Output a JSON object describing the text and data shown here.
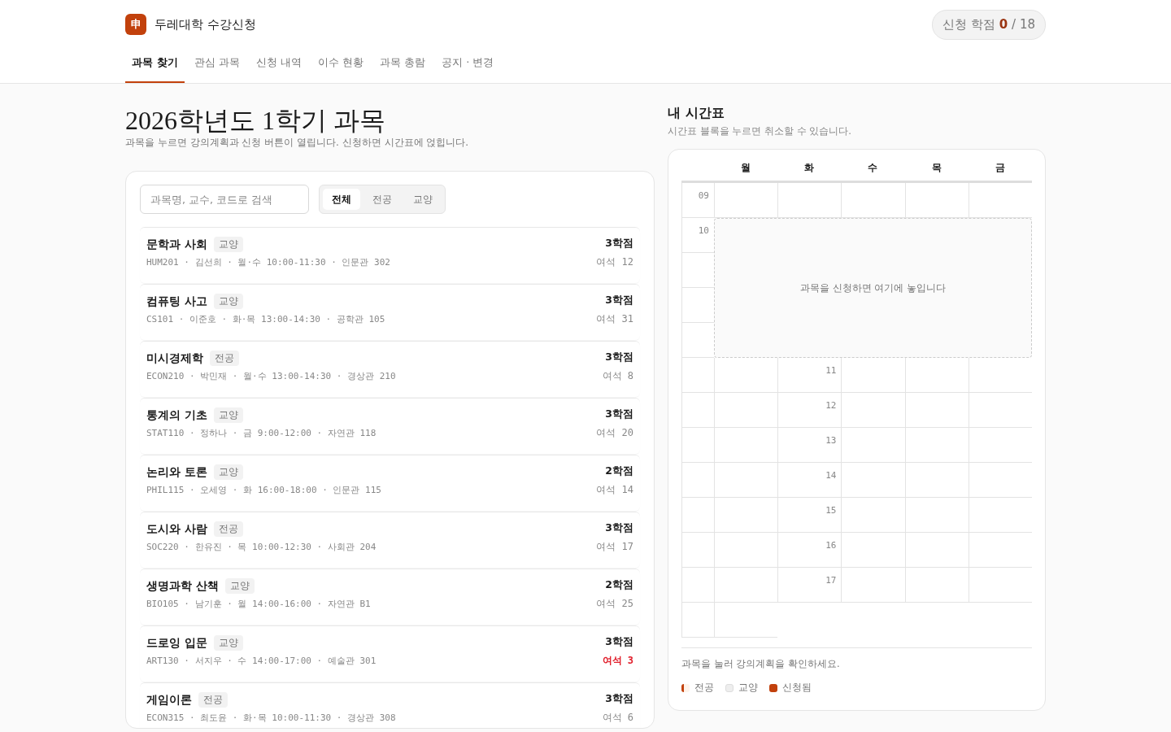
{
  "brand": {
    "logo": "申",
    "name": "두레대학 수강신청"
  },
  "credits": {
    "label": "신청 학점",
    "value": "0",
    "total": "/ 18"
  },
  "tabs": [
    {
      "label": "과목 찾기",
      "selected": true
    },
    {
      "label": "관심 과목",
      "selected": false
    },
    {
      "label": "신청 내역",
      "selected": false
    },
    {
      "label": "이수 현황",
      "selected": false
    },
    {
      "label": "과목 총람",
      "selected": false
    },
    {
      "label": "공지 · 변경",
      "selected": false
    }
  ],
  "page": {
    "title": "2026학년도 1학기 과목",
    "subtitle": "과목을 누르면 강의계획과 신청 버튼이 열립니다. 신청하면 시간표에 얹힙니다."
  },
  "search": {
    "placeholder": "과목명, 교수, 코드로 검색"
  },
  "filters": [
    {
      "label": "전체",
      "selected": true
    },
    {
      "label": "전공",
      "selected": false
    },
    {
      "label": "교양",
      "selected": false
    }
  ],
  "courses": [
    {
      "name": "문학과 사회",
      "tag": "교양",
      "meta": "HUM201 · 김선희 · 월·수 10:00-11:30 · 인문관 302",
      "credits": "3학점",
      "seats": "여석 12",
      "low": false
    },
    {
      "name": "컴퓨팅 사고",
      "tag": "교양",
      "meta": "CS101 · 이준호 · 화·목 13:00-14:30 · 공학관 105",
      "credits": "3학점",
      "seats": "여석 31",
      "low": false
    },
    {
      "name": "미시경제학",
      "tag": "전공",
      "meta": "ECON210 · 박민재 · 월·수 13:00-14:30 · 경상관 210",
      "credits": "3학점",
      "seats": "여석 8",
      "low": false
    },
    {
      "name": "통계의 기초",
      "tag": "교양",
      "meta": "STAT110 · 정하나 · 금 9:00-12:00 · 자연관 118",
      "credits": "3학점",
      "seats": "여석 20",
      "low": false
    },
    {
      "name": "논리와 토론",
      "tag": "교양",
      "meta": "PHIL115 · 오세영 · 화 16:00-18:00 · 인문관 115",
      "credits": "2학점",
      "seats": "여석 14",
      "low": false
    },
    {
      "name": "도시와 사람",
      "tag": "전공",
      "meta": "SOC220 · 한유진 · 목 10:00-12:30 · 사회관 204",
      "credits": "3학점",
      "seats": "여석 17",
      "low": false
    },
    {
      "name": "생명과학 산책",
      "tag": "교양",
      "meta": "BIO105 · 남기훈 · 월 14:00-16:00 · 자연관 B1",
      "credits": "2학점",
      "seats": "여석 25",
      "low": false
    },
    {
      "name": "드로잉 입문",
      "tag": "교양",
      "meta": "ART130 · 서지우 · 수 14:00-17:00 · 예술관 301",
      "credits": "3학점",
      "seats": "여석 3",
      "low": true
    },
    {
      "name": "게임이론",
      "tag": "전공",
      "meta": "ECON315 · 최도윤 · 화·목 10:00-11:30 · 경상관 308",
      "credits": "3학점",
      "seats": "여석 6",
      "low": false
    }
  ],
  "timetable": {
    "title": "내 시간표",
    "subtitle": "시간표 블록을 누르면 취소할 수 있습니다.",
    "days": [
      "월",
      "화",
      "수",
      "목",
      "금"
    ],
    "hours": [
      "09",
      "10",
      "11",
      "12",
      "13",
      "14",
      "15",
      "16",
      "17"
    ],
    "empty_message": "과목을 신청하면 여기에 놓입니다",
    "hint": "과목을 눌러 강의계획을 확인하세요.",
    "legend": [
      {
        "label": "전공",
        "kind": "major"
      },
      {
        "label": "교양",
        "kind": "general"
      },
      {
        "label": "신청됨",
        "kind": "enrolled"
      }
    ]
  }
}
